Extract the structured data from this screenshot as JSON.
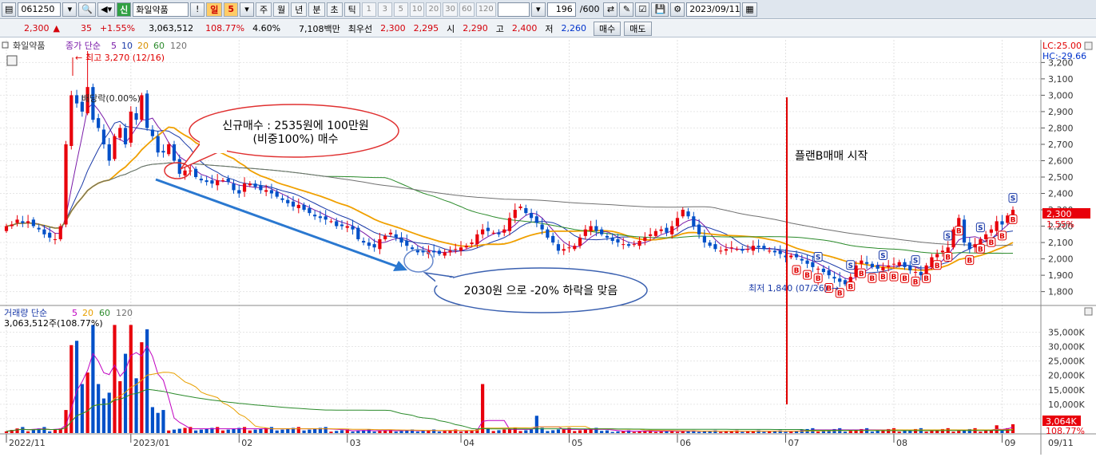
{
  "toolbar": {
    "code": "061250",
    "stock_name": "화일약품",
    "new_badge": "신",
    "periods": [
      "일",
      "5",
      "주",
      "월",
      "년",
      "분",
      "초",
      "틱"
    ],
    "active_period": "일",
    "tick_options": [
      "1",
      "3",
      "5",
      "10",
      "20",
      "30",
      "60",
      "120"
    ],
    "count": "196",
    "count_total": "/600",
    "date": "2023/09/11"
  },
  "quote": {
    "price": "2,300",
    "change": "35",
    "change_pct": "+1.55%",
    "volume": "3,063,512",
    "volume_ratio": "108.77%",
    "turnover": "4.60%",
    "amount": "7,108백만",
    "best_ask_label": "최우선",
    "best_ask": "2,300",
    "best_bid": "2,295",
    "open_label": "시",
    "open": "2,290",
    "high_label": "고",
    "high": "2,400",
    "low_label": "저",
    "low": "2,260",
    "buy_label": "매수",
    "sell_label": "매도"
  },
  "price_panel": {
    "stock_label": "화일약품",
    "legend_prefix": "종가 단순",
    "ma_periods": [
      "5",
      "10",
      "20",
      "60",
      "120"
    ],
    "high_marker": "최고 3,270 (12/16)",
    "low_marker": "최저 1,840 (07/26)",
    "dividend_marker": "배당락(0.00%)",
    "lc": "LC:25.00",
    "hc": "HC:-29.66",
    "current_price_tag": "2,300",
    "current_pct_tag": "1.55%"
  },
  "volume_panel": {
    "legend_prefix": "거래량 단순",
    "ma_periods": [
      "5",
      "20",
      "60",
      "120"
    ],
    "current_volume": "3,063,512주(108.77%)",
    "current_tag": "3,064K",
    "pct_tag": "108.77%"
  },
  "annotations": {
    "buy_note_line1": "신규매수 : 2535원에 100만원",
    "buy_note_line2": "(비중100%) 매수",
    "plan_note": "플랜B매매 시작",
    "drop_note": "2030원 으로 -20% 하락을 맞음"
  },
  "colors": {
    "up": "#e8000b",
    "down": "#0050c8",
    "ma5": "#7a1aa8",
    "ma10": "#1a3aa8",
    "ma20": "#f0a000",
    "ma60": "#2a8a2a",
    "ma120": "#707070",
    "vol_ma5": "#c000c0",
    "vol_ma20": "#e8a000",
    "vol_ma60": "#2a8a2a",
    "trend_arrow": "#2a78d0",
    "plan_line": "#e00000"
  },
  "chart_data": {
    "type": "candlestick",
    "x_ticks": [
      "2022/11",
      "2023/01",
      "02",
      "03",
      "04",
      "05",
      "06",
      "07",
      "08",
      "09"
    ],
    "x_tick_index": [
      0,
      23,
      43,
      63,
      84,
      104,
      124,
      144,
      164,
      184
    ],
    "end_date_label": "09/11",
    "y_ticks": [
      1800,
      1900,
      2000,
      2100,
      2200,
      2300,
      2400,
      2500,
      2600,
      2700,
      2800,
      2900,
      3000,
      3100,
      3200
    ],
    "y_range": [
      1730,
      3270
    ],
    "vol_ticks": [
      "5,000K",
      "10,000K",
      "15,000K",
      "20,000K",
      "25,000K",
      "30,000K",
      "35,000K"
    ],
    "vol_tick_values": [
      5000,
      10000,
      15000,
      20000,
      25000,
      30000,
      35000
    ],
    "vol_range": [
      0,
      39000
    ],
    "closes": [
      2200,
      2210,
      2240,
      2220,
      2230,
      2200,
      2180,
      2150,
      2130,
      2120,
      2200,
      2700,
      3000,
      2950,
      2900,
      3050,
      2850,
      2800,
      2700,
      2600,
      2750,
      2800,
      2700,
      2900,
      2850,
      3000,
      2800,
      2750,
      2650,
      2650,
      2700,
      2600,
      2520,
      2540,
      2540,
      2500,
      2480,
      2470,
      2460,
      2480,
      2480,
      2470,
      2420,
      2400,
      2460,
      2460,
      2440,
      2420,
      2420,
      2400,
      2380,
      2360,
      2340,
      2320,
      2330,
      2300,
      2280,
      2260,
      2250,
      2240,
      2230,
      2200,
      2200,
      2200,
      2180,
      2120,
      2100,
      2080,
      2070,
      2120,
      2140,
      2160,
      2130,
      2100,
      2080,
      2060,
      2040,
      2040,
      2050,
      2040,
      2030,
      2040,
      2050,
      2060,
      2070,
      2080,
      2100,
      2150,
      2180,
      2170,
      2160,
      2150,
      2180,
      2250,
      2300,
      2320,
      2280,
      2250,
      2220,
      2180,
      2130,
      2100,
      2050,
      2060,
      2070,
      2080,
      2130,
      2180,
      2200,
      2170,
      2150,
      2130,
      2110,
      2100,
      2090,
      2080,
      2090,
      2110,
      2130,
      2150,
      2170,
      2180,
      2160,
      2200,
      2250,
      2300,
      2260,
      2200,
      2150,
      2100,
      2080,
      2060,
      2050,
      2060,
      2070,
      2060,
      2050,
      2060,
      2080,
      2070,
      2060,
      2050,
      2040,
      2030,
      2010,
      2020,
      2010,
      1990,
      1970,
      1950,
      1940,
      1920,
      1900,
      1880,
      1860,
      1845,
      1890,
      1960,
      1990,
      1970,
      1950,
      1940,
      1950,
      1960,
      1970,
      1980,
      1950,
      1930,
      1920,
      1900,
      1960,
      2010,
      2030,
      2050,
      2070,
      2180,
      2250,
      2100,
      2060,
      2090,
      2120,
      2150,
      2180,
      2230,
      2210,
      2265,
      2300
    ]
  }
}
